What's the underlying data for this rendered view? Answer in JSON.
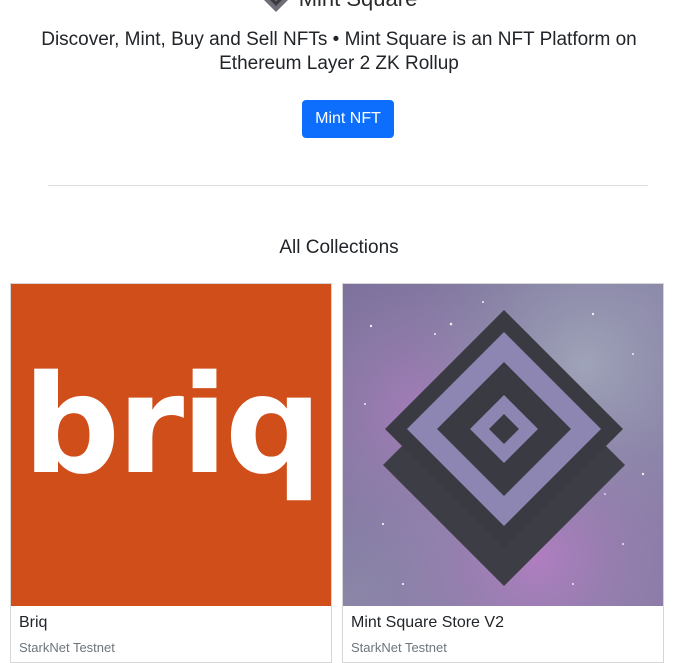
{
  "header": {
    "brand_name": "Mint Square",
    "tagline": "Discover, Mint, Buy and Sell NFTs • Mint Square is an NFT Platform on Ethereum Layer 2 ZK Rollup",
    "mint_button_label": "Mint NFT",
    "logo_icon": "mint-square-logo-icon"
  },
  "collections": {
    "title": "All Collections",
    "items": [
      {
        "name": "Briq",
        "network": "StarkNet Testnet",
        "image_text": "briq",
        "image_bg": "#d04e1a"
      },
      {
        "name": "Mint Square Store V2",
        "network": "StarkNet Testnet",
        "image_icon": "mint-square-diamond-icon"
      }
    ]
  },
  "colors": {
    "primary": "#0d6efd",
    "briq_orange": "#d04e1a",
    "logo_dark": "#3a3a3f",
    "logo_light": "#8e86b8"
  }
}
